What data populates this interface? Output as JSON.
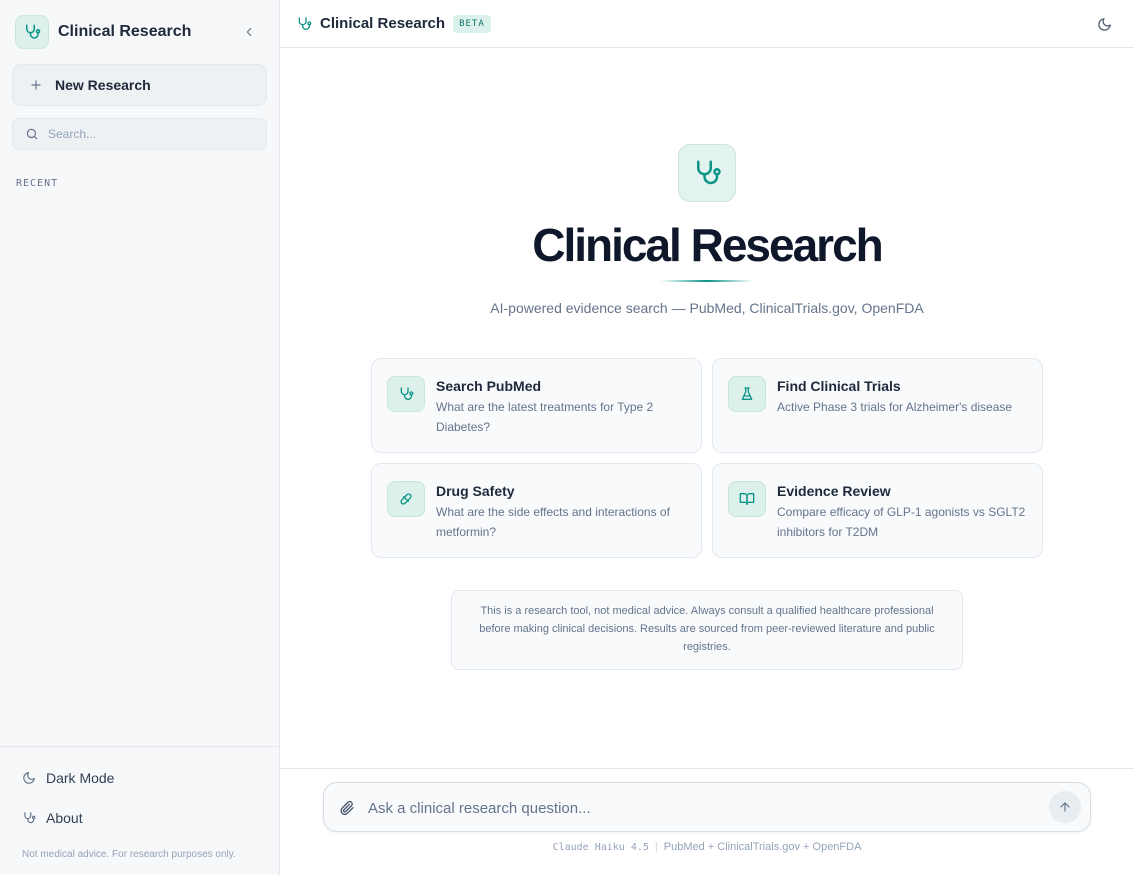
{
  "app": {
    "name": "Clinical Research"
  },
  "colors": {
    "accent": "#0d9488",
    "accent_bg": "#dcf1ec"
  },
  "sidebar": {
    "new_research_label": "New Research",
    "search_placeholder": "Search...",
    "recent_label": "RECENT",
    "footer": {
      "dark_mode_label": "Dark Mode",
      "about_label": "About",
      "note": "Not medical advice. For research purposes only."
    }
  },
  "topbar": {
    "title": "Clinical Research",
    "badge": "BETA"
  },
  "hero": {
    "title": "Clinical Research",
    "subtitle": "AI-powered evidence search — PubMed, ClinicalTrials.gov, OpenFDA"
  },
  "cards": [
    {
      "title": "Search PubMed",
      "description": "What are the latest treatments for Type 2 Diabetes?",
      "icon": "stethoscope-icon"
    },
    {
      "title": "Find Clinical Trials",
      "description": "Active Phase 3 trials for Alzheimer's disease",
      "icon": "flask-icon"
    },
    {
      "title": "Drug Safety",
      "description": "What are the side effects and interactions of metformin?",
      "icon": "pill-icon"
    },
    {
      "title": "Evidence Review",
      "description": "Compare efficacy of GLP-1 agonists vs SGLT2 inhibitors for T2DM",
      "icon": "book-open-icon"
    }
  ],
  "disclaimer": "This is a research tool, not medical advice. Always consult a qualified healthcare professional before making clinical decisions. Results are sourced from peer-reviewed literature and public registries.",
  "composer": {
    "placeholder": "Ask a clinical research question...",
    "model": "Claude Haiku 4.5",
    "sources": "PubMed + ClinicalTrials.gov + OpenFDA"
  }
}
